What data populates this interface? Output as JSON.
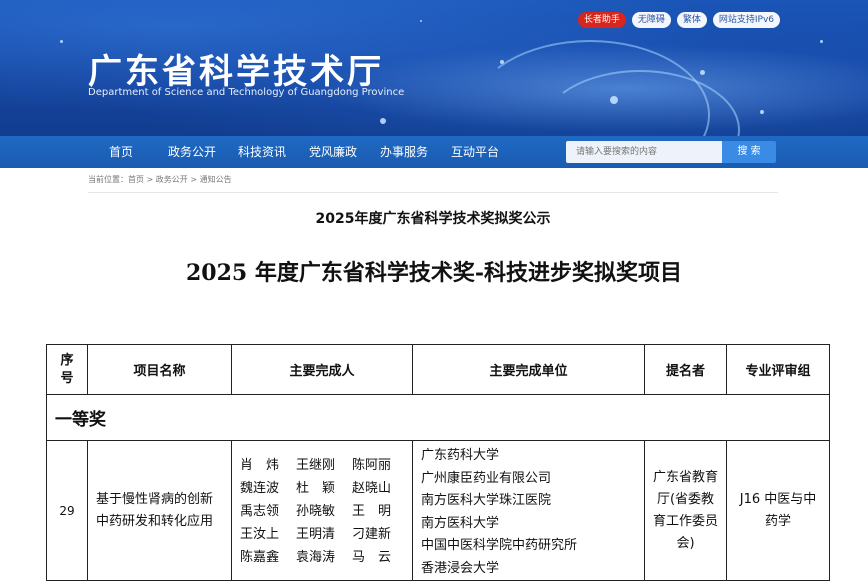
{
  "header": {
    "site_title": "广东省科学技术厅",
    "site_subtitle": "Department of Science and Technology of Guangdong Province",
    "top_links": [
      "长者助手",
      "无障碍",
      "繁体",
      "网站支持IPv6"
    ],
    "colors": {
      "banner": "#1545a0",
      "nav": "#1f69c4",
      "accent_red": "#d8261e"
    }
  },
  "nav": {
    "items": [
      "首页",
      "政务公开",
      "科技资讯",
      "党风廉政",
      "办事服务",
      "互动平台"
    ],
    "search_placeholder": "请输入要搜索的内容",
    "search_button": "搜 索"
  },
  "breadcrumb": "当前位置：首页 > 政务公开 > 通知公告",
  "notice_title": "2025年度广东省科学技术奖拟奖公示",
  "doc_title": "2025 年度广东省科学技术奖-科技进步奖拟奖项目",
  "table": {
    "headers": {
      "seq_line1": "序",
      "seq_line2": "号",
      "project": "项目名称",
      "people": "主要完成人",
      "units": "主要完成单位",
      "nominator": "提名者",
      "group": "专业评审组"
    },
    "grade": "一等奖",
    "row": {
      "number": "29",
      "project": "基于慢性肾病的创新中药研发和转化应用",
      "people": [
        "肖　炜",
        "王继刚",
        "陈阿丽",
        "魏连波",
        "杜　颖",
        "赵晓山",
        "禹志领",
        "孙晓敏",
        "王　明",
        "王汝上",
        "王明清",
        "刁建新",
        "陈嘉錱",
        "袁海涛",
        "马　云"
      ],
      "units": [
        "广东药科大学",
        "广州康臣药业有限公司",
        "南方医科大学珠江医院",
        "南方医科大学",
        "中国中医科学院中药研究所",
        "香港浸会大学"
      ],
      "nominator": "广东省教育厅(省委教育工作委员会)",
      "group": "J16 中医与中药学"
    }
  }
}
